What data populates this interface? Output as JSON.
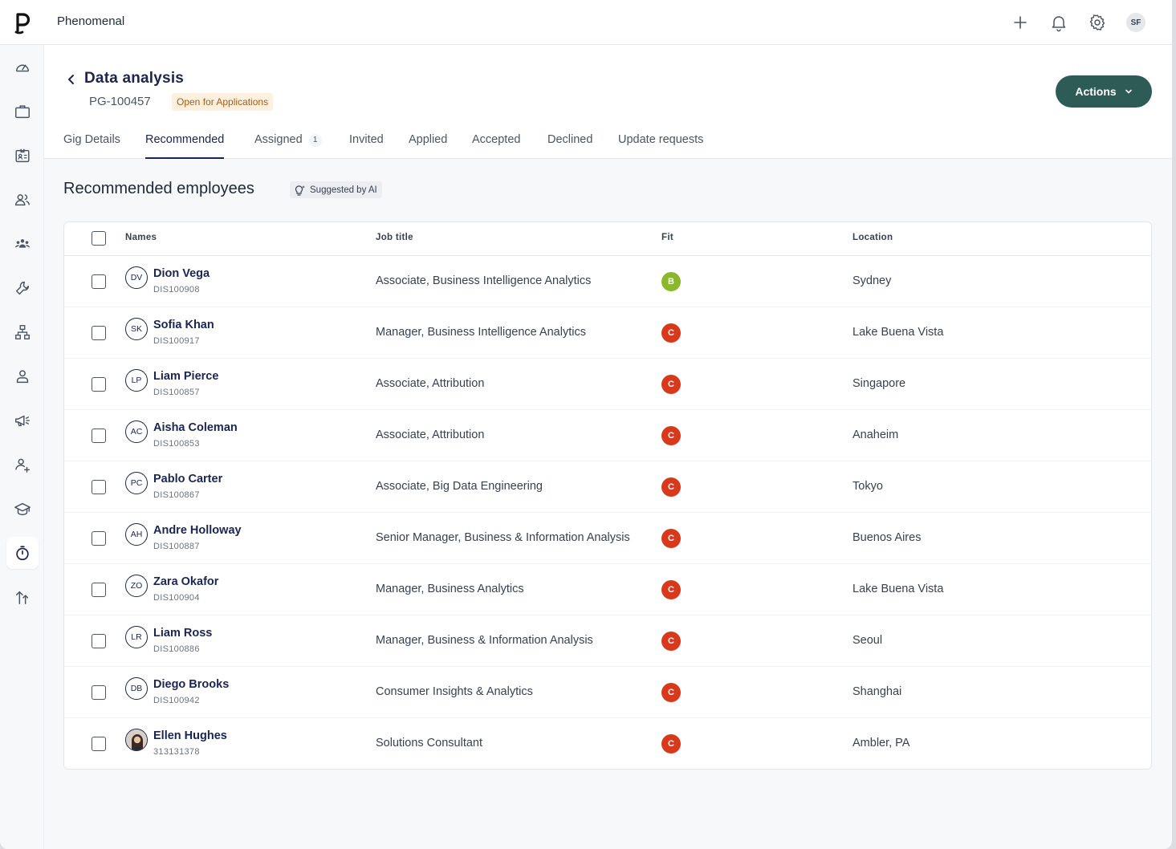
{
  "app": {
    "brand": "Phenomenal",
    "user_initials": "SF"
  },
  "colors": {
    "accent": "#2d5b55",
    "navy": "#1b2453",
    "fit_b": "#8ab82b",
    "fit_c": "#d8391c",
    "status_bg": "#fdf0de",
    "status_text": "#a55d17"
  },
  "topbar_icons": [
    "plus-icon",
    "bell-icon",
    "gear-icon"
  ],
  "sidebar": {
    "items": [
      {
        "icon": "dashboard-icon"
      },
      {
        "icon": "briefcase-icon"
      },
      {
        "icon": "id-card-icon"
      },
      {
        "icon": "people-icon"
      },
      {
        "icon": "team-icon"
      },
      {
        "icon": "wrench-icon"
      },
      {
        "icon": "org-chart-icon"
      },
      {
        "icon": "person-icon"
      },
      {
        "icon": "megaphone-icon"
      },
      {
        "icon": "user-group-icon"
      },
      {
        "icon": "graduation-cap-icon"
      },
      {
        "icon": "stopwatch-icon",
        "active": true
      },
      {
        "icon": "career-path-icon"
      }
    ]
  },
  "header": {
    "title": "Data analysis",
    "gig_id": "PG-100457",
    "status": "Open for Applications",
    "actions_label": "Actions"
  },
  "tabs": [
    {
      "label": "Gig Details"
    },
    {
      "label": "Recommended",
      "active": true
    },
    {
      "label": "Assigned",
      "count": "1"
    },
    {
      "label": "Invited"
    },
    {
      "label": "Applied"
    },
    {
      "label": "Accepted"
    },
    {
      "label": "Declined"
    },
    {
      "label": "Update requests"
    }
  ],
  "section": {
    "title": "Recommended employees",
    "ai_badge": "Suggested by AI"
  },
  "table": {
    "columns": [
      "Names",
      "Job title",
      "Fit",
      "Location"
    ],
    "rows": [
      {
        "initials": "DV",
        "name": "Dion Vega",
        "id": "DIS100908",
        "job": "Associate, Business Intelligence Analytics",
        "fit": "B",
        "location": "Sydney"
      },
      {
        "initials": "SK",
        "name": "Sofia Khan",
        "id": "DIS100917",
        "job": "Manager, Business Intelligence Analytics",
        "fit": "C",
        "location": "Lake Buena Vista"
      },
      {
        "initials": "LP",
        "name": "Liam Pierce",
        "id": "DIS100857",
        "job": "Associate, Attribution",
        "fit": "C",
        "location": "Singapore"
      },
      {
        "initials": "AC",
        "name": "Aisha Coleman",
        "id": "DIS100853",
        "job": "Associate, Attribution",
        "fit": "C",
        "location": "Anaheim"
      },
      {
        "initials": "PC",
        "name": "Pablo Carter",
        "id": "DIS100867",
        "job": "Associate, Big Data Engineering",
        "fit": "C",
        "location": "Tokyo"
      },
      {
        "initials": "AH",
        "name": "Andre Holloway",
        "id": "DIS100887",
        "job": "Senior Manager, Business & Information Analysis",
        "fit": "C",
        "location": "Buenos Aires"
      },
      {
        "initials": "ZO",
        "name": "Zara Okafor",
        "id": "DIS100904",
        "job": "Manager, Business Analytics",
        "fit": "C",
        "location": "Lake Buena Vista"
      },
      {
        "initials": "LR",
        "name": "Liam Ross",
        "id": "DIS100886",
        "job": "Manager, Business & Information Analysis",
        "fit": "C",
        "location": "Seoul"
      },
      {
        "initials": "DB",
        "name": "Diego Brooks",
        "id": "DIS100942",
        "job": "Consumer Insights & Analytics",
        "fit": "C",
        "location": "Shanghai"
      },
      {
        "initials": "",
        "photo": true,
        "name": "Ellen Hughes",
        "id": "313131378",
        "job": "Solutions Consultant",
        "fit": "C",
        "location": "Ambler, PA"
      }
    ]
  }
}
